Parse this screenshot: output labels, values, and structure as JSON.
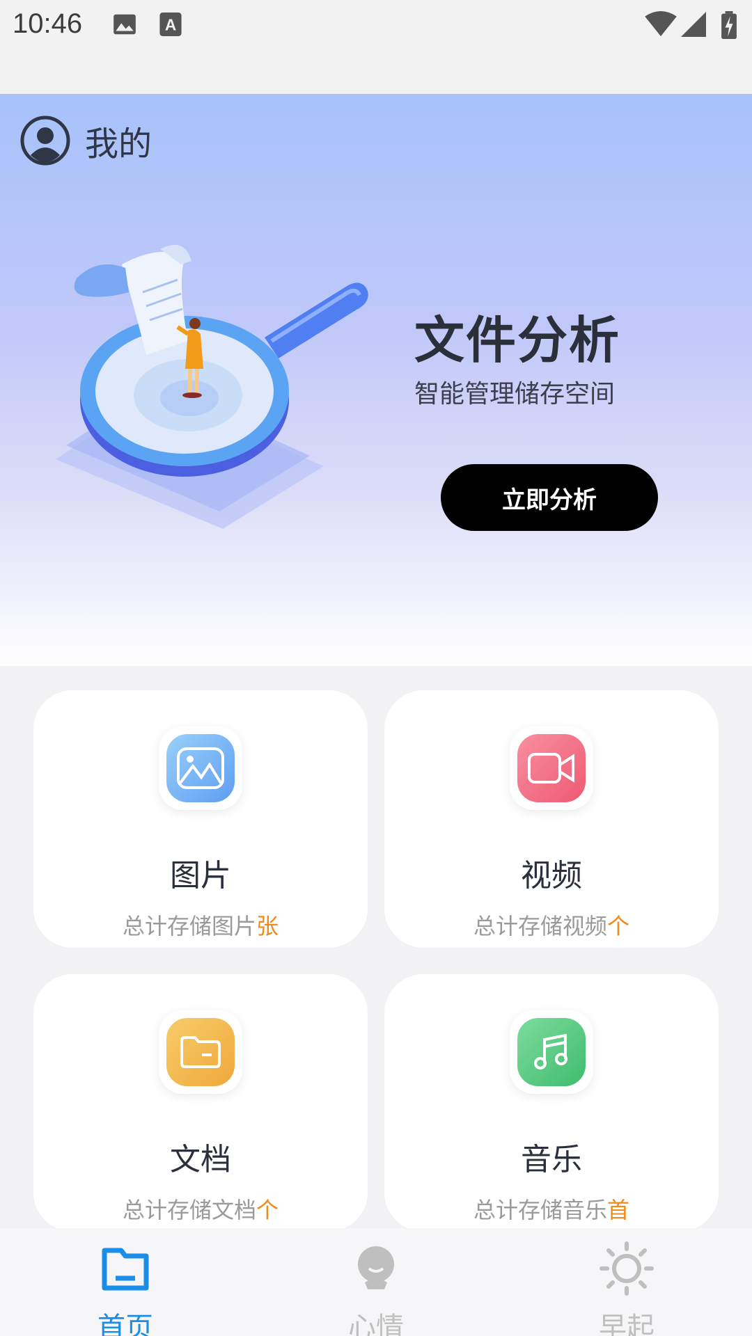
{
  "status_bar": {
    "time": "10:46"
  },
  "header": {
    "profile_label": "我的"
  },
  "hero": {
    "title": "文件分析",
    "subtitle": "智能管理储存空间",
    "button_label": "立即分析"
  },
  "cards": [
    {
      "title": "图片",
      "desc": "总计存储图片",
      "unit": "张",
      "icon": "image-icon",
      "color": "#7fb8f5"
    },
    {
      "title": "视频",
      "desc": "总计存储视频",
      "unit": "个",
      "icon": "video-camera-icon",
      "color": "#f27185"
    },
    {
      "title": "文档",
      "desc": "总计存储文档",
      "unit": "个",
      "icon": "folder-icon",
      "color": "#f2b84f"
    },
    {
      "title": "音乐",
      "desc": "总计存储音乐",
      "unit": "首",
      "icon": "music-note-icon",
      "color": "#5fce86"
    }
  ],
  "tabs": [
    {
      "label": "首页",
      "icon": "folder-icon",
      "active": true
    },
    {
      "label": "心情",
      "icon": "face-icon",
      "active": false
    },
    {
      "label": "早起",
      "icon": "sun-icon",
      "active": false
    }
  ],
  "colors": {
    "accent": "#1a8de8",
    "inactive_tab": "#bfbfbf",
    "count_accent": "#f08a1a"
  }
}
